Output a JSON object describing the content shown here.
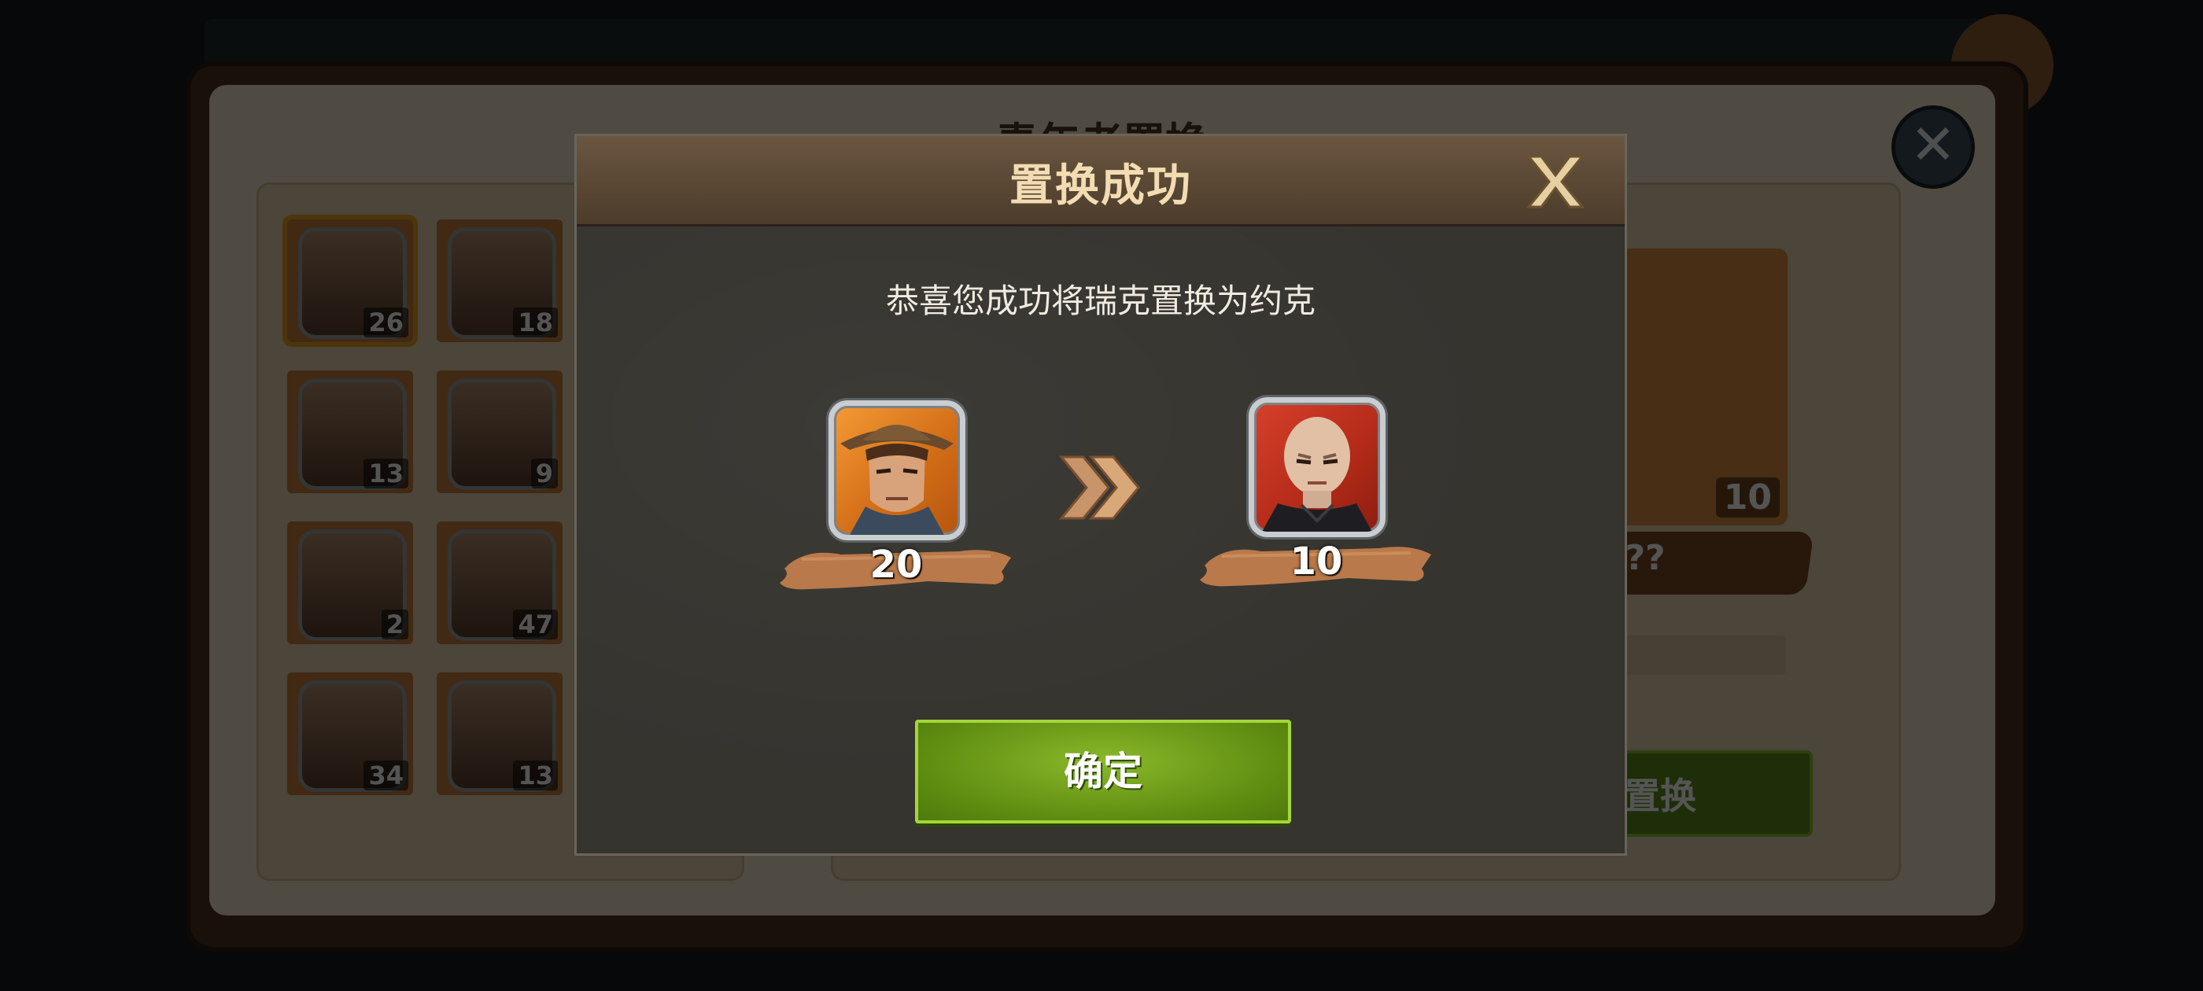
{
  "background": {
    "screen_title": "青年老置换",
    "hero_list": [
      {
        "level": "26",
        "selected": true
      },
      {
        "level": "18",
        "selected": false
      },
      {
        "level": "13",
        "selected": false
      },
      {
        "level": "9",
        "selected": false
      },
      {
        "level": "2",
        "selected": false
      },
      {
        "level": "47",
        "selected": false
      },
      {
        "level": "34",
        "selected": false
      },
      {
        "level": "13",
        "selected": false
      }
    ],
    "target_level": "10",
    "target_name": "???",
    "swap_button_label": "置换"
  },
  "dialog": {
    "title": "置换成功",
    "message": "恭喜您成功将瑞克置换为约克",
    "from_hero": {
      "level": "20",
      "icon": "hero-portrait-cowboy-icon",
      "frame_color": "#e8831f"
    },
    "to_hero": {
      "level": "10",
      "icon": "hero-portrait-bald-icon",
      "frame_color": "#c63420"
    },
    "arrow_icon": "double-chevron-right-icon",
    "close_icon": "close-x-icon",
    "confirm_label": "确定"
  },
  "colors": {
    "header_title": "#f3dcb2",
    "confirm_button": "#6e9c18",
    "ribbon": "#b9794a"
  }
}
